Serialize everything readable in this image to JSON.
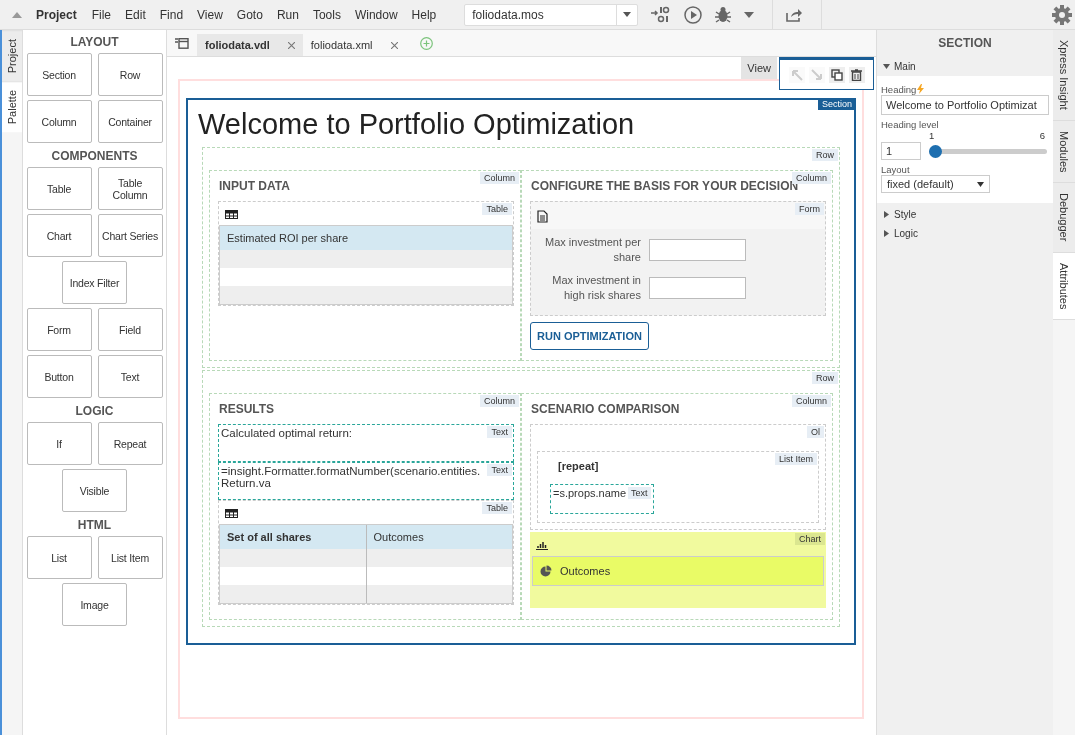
{
  "menu_title": "Project",
  "menu": [
    "File",
    "Edit",
    "Find",
    "View",
    "Goto",
    "Run",
    "Tools",
    "Window",
    "Help"
  ],
  "file_select": {
    "value": "foliodata.mos"
  },
  "left_tabs": [
    {
      "label": "Project",
      "selected": false
    },
    {
      "label": "Palette",
      "selected": true
    }
  ],
  "palette": [
    {
      "title": "LAYOUT",
      "rows": [
        [
          "Section",
          "Row"
        ],
        [
          "Column",
          "Container"
        ]
      ]
    },
    {
      "title": "COMPONENTS",
      "rows": [
        [
          "Table",
          "Table Column"
        ],
        [
          "Chart",
          "Chart Series"
        ],
        [
          "Index Filter"
        ],
        [
          "Form",
          "Field"
        ],
        [
          "Button",
          "Text"
        ]
      ]
    },
    {
      "title": "LOGIC",
      "rows": [
        [
          "If",
          "Repeat"
        ],
        [
          "Visible"
        ]
      ]
    },
    {
      "title": "HTML",
      "rows": [
        [
          "List",
          "List Item"
        ],
        [
          "Image"
        ]
      ]
    }
  ],
  "editor_tabs": [
    {
      "label": "foliodata.vdl",
      "selected": true
    },
    {
      "label": "foliodata.xml",
      "selected": false
    }
  ],
  "view_button": "View",
  "section_actions": [
    {
      "kind": "up",
      "disabled": true
    },
    {
      "kind": "down",
      "disabled": true
    },
    {
      "kind": "copy",
      "disabled": false
    },
    {
      "kind": "delete",
      "disabled": false
    }
  ],
  "section": {
    "tag": "Section",
    "heading": "Welcome to Portfolio Optimization",
    "rows": [
      {
        "tag": "Row",
        "columns": [
          {
            "tag": "Column",
            "heading": "INPUT DATA",
            "blocks": [
              {
                "kind": "table",
                "tag": "Table",
                "columns": [
                  {
                    "label": "Estimated ROI per share",
                    "bold": false
                  }
                ]
              }
            ]
          },
          {
            "tag": "Column",
            "heading": "CONFIGURE THE BASIS FOR YOUR DECISION",
            "blocks": [
              {
                "kind": "form",
                "tag": "Form",
                "fields": [
                  {
                    "label": "Max investment per share"
                  },
                  {
                    "label": "Max investment in high risk shares"
                  }
                ]
              },
              {
                "kind": "button",
                "label": "RUN OPTIMIZATION"
              }
            ]
          }
        ]
      },
      {
        "tag": "Row",
        "columns": [
          {
            "tag": "Column",
            "heading": "RESULTS",
            "blocks": [
              {
                "kind": "text",
                "tag": "Text",
                "text": "Calculated optimal return:"
              },
              {
                "kind": "text",
                "tag": "Text",
                "text": "=insight.Formatter.formatNumber(scenario.entities.Return.va"
              },
              {
                "kind": "table",
                "tag": "Table",
                "columns": [
                  {
                    "label": "Set of all shares",
                    "bold": true
                  },
                  {
                    "label": "Outcomes",
                    "bold": false
                  }
                ]
              }
            ]
          },
          {
            "tag": "Column",
            "heading": "SCENARIO COMPARISON",
            "blocks": [
              {
                "kind": "list",
                "tag": "Ol",
                "item": {
                  "tag": "List Item",
                  "label": "[repeat]",
                  "text_tag": "Text",
                  "text": "=s.props.name"
                }
              },
              {
                "kind": "chart",
                "tag": "Chart",
                "series": "Outcomes"
              }
            ]
          }
        ]
      }
    ]
  },
  "inspector": {
    "title": "SECTION",
    "groups": [
      {
        "label": "Main",
        "expanded": true
      },
      {
        "label": "Style",
        "expanded": false
      },
      {
        "label": "Logic",
        "expanded": false
      }
    ],
    "heading_label": "Heading",
    "heading_value": "Welcome to Portfolio Optimizat",
    "level_label": "Heading level",
    "level_value": "1",
    "level_min": "1",
    "level_max": "6",
    "level": 0,
    "layout_label": "Layout",
    "layout_value": "fixed (default)"
  },
  "right_tabs": [
    {
      "label": "Xpress Insight",
      "selected": false
    },
    {
      "label": "Modules",
      "selected": false
    },
    {
      "label": "Debugger",
      "selected": false
    },
    {
      "label": "Attributes",
      "selected": true
    }
  ]
}
